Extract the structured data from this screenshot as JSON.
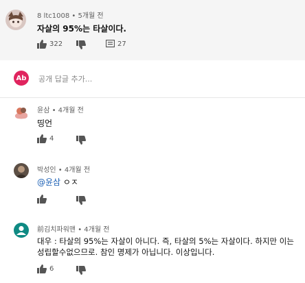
{
  "parent_comment": {
    "author": "8 ltc1008",
    "time": "5개월 전",
    "text": "자살의 95%는 타살이다.",
    "likes": "322",
    "replies": "27"
  },
  "reply_box": {
    "avatar_initials": "Ab",
    "placeholder": "공개 답글 추가..."
  },
  "replies": [
    {
      "author": "윤삼",
      "time": "4개월 전",
      "mention": "",
      "text": "띵언",
      "likes": "4"
    },
    {
      "author": "박성인",
      "time": "4개월 전",
      "mention": "@윤삼",
      "text": "ㅇㅈ",
      "likes": ""
    },
    {
      "author": "前김치파워맨",
      "time": "4개월 전",
      "mention": "",
      "text_line1": "대우 : 타살의 95%는 자살이 아니다. 즉, 타살의 5%는 자살이다. 하지만 이는",
      "text_line2": "성립할수없으므로. 참인 명제가 아닙니다. 이상입니다.",
      "likes": "6"
    }
  ],
  "colors": {
    "accent": "#e0245e",
    "mention": "#1a5fb4",
    "highlight_bg": "#f5f5f5"
  },
  "icons": [
    "thumb-up-icon",
    "thumb-down-icon",
    "reply-comment-icon"
  ]
}
